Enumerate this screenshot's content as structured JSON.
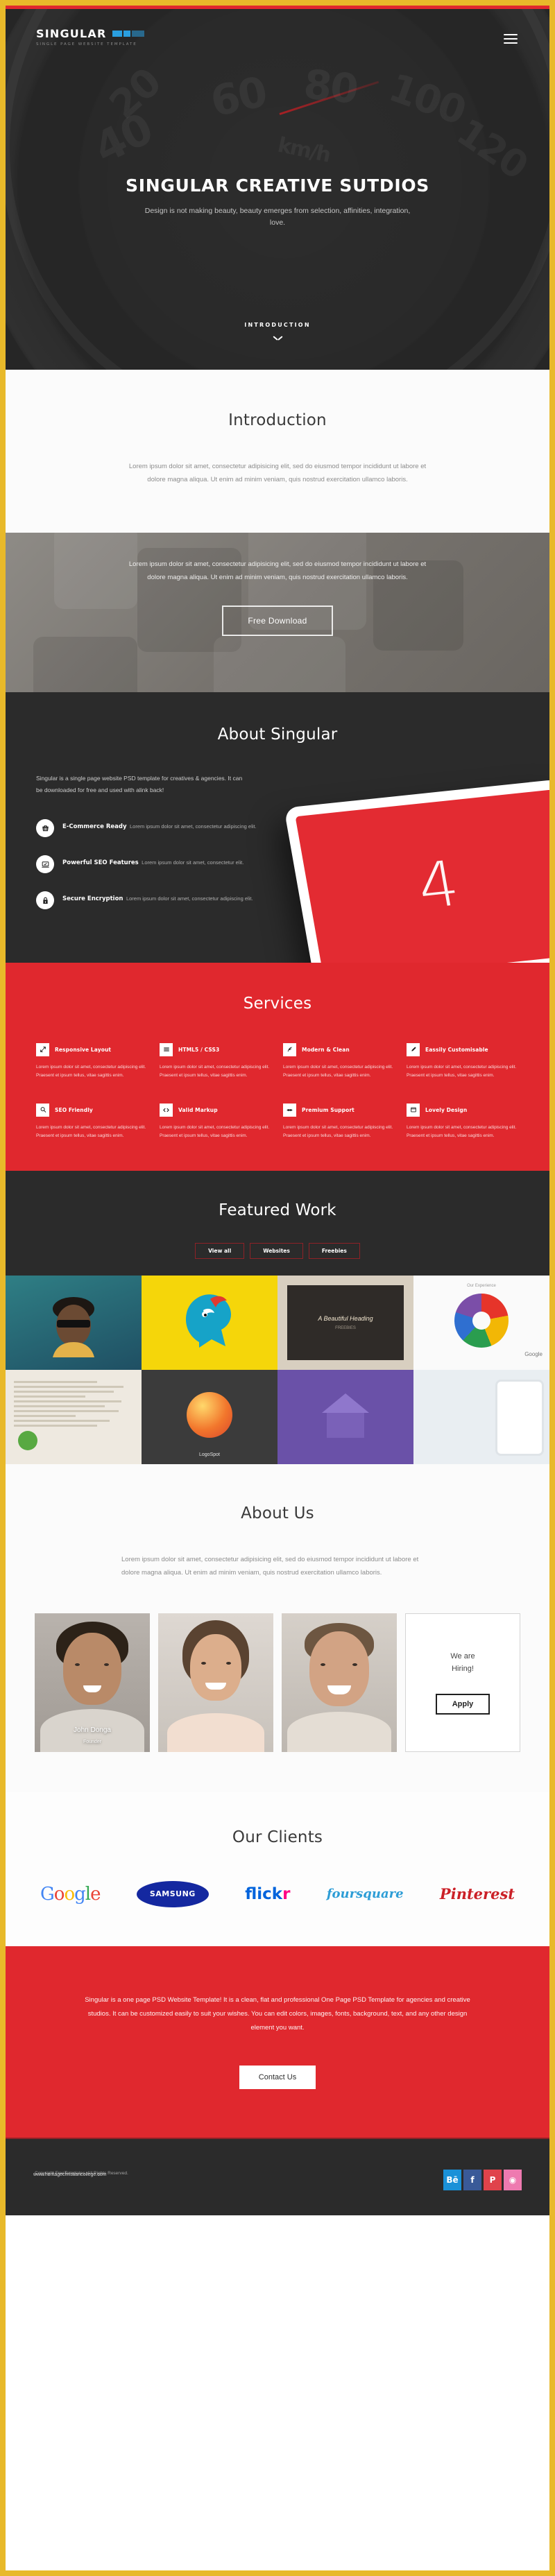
{
  "brand": {
    "logo_text": "SINGULAR",
    "logo_sub": "SINGLE PAGE WEBSITE TEMPLATE",
    "accent_red": "#e0282e",
    "accent_blue": "#2a9fe0",
    "page_border": "#e8b92a"
  },
  "hero": {
    "title": "SINGULAR CREATIVE SUTDIOS",
    "subtitle": "Design is not making beauty, beauty emerges from selection, affinities, integration, love.",
    "scroll_label": "INTRODUCTION",
    "menu_icon": "hamburger-menu-icon",
    "chevron_icon": "chevron-down-icon",
    "speedo_numbers": [
      "20",
      "40",
      "60",
      "80",
      "100",
      "120",
      "km/h"
    ]
  },
  "introduction": {
    "heading": "Introduction",
    "body": "Lorem ipsum dolor sit amet, consectetur adipisicing elit, sed do eiusmod tempor incididunt ut labore et dolore magna aliqua. Ut enim ad minim veniam, quis nostrud exercitation ullamco laboris."
  },
  "download": {
    "body": "Lorem ipsum dolor sit amet, consectetur adipisicing elit, sed do eiusmod tempor incididunt ut labore et dolore magna aliqua. Ut enim ad minim veniam, quis nostrud exercitation ullamco laboris.",
    "button": "Free Download"
  },
  "about_singular": {
    "heading": "About Singular",
    "lead": "Singular is a single page website PSD template for creatives & agencies. It can be downloaded for free and used with alink back!",
    "features": [
      {
        "icon": "shopping-basket-icon",
        "title": "E-Commerce Ready",
        "desc": "Lorem ipsum dolor sit amet, consectetur adipiscing elit."
      },
      {
        "icon": "laptop-check-icon",
        "title": "Powerful SEO Features",
        "desc": "Lorem ipsum dolor sit amet, consectetur elit."
      },
      {
        "icon": "lock-icon",
        "title": "Secure Encryption",
        "desc": "Lorem ipsum dolor sit amet, consectetur adipiscing elit."
      }
    ],
    "tablet_glyph": "4"
  },
  "services": {
    "heading": "Services",
    "items": [
      {
        "icon": "resize-arrows-icon",
        "title": "Responsive Layout",
        "desc": "Lorem ipsum dolor sit amet, consectetur adipiscing elit. Praesent et ipsum tellus, vitae sagittis enim."
      },
      {
        "icon": "list-lines-icon",
        "title": "HTML5 / CSS3",
        "desc": "Lorem ipsum dolor sit amet, consectetur adipiscing elit. Praesent et ipsum tellus, vitae sagittis enim."
      },
      {
        "icon": "feather-icon",
        "title": "Modern & Clean",
        "desc": "Lorem ipsum dolor sit amet, consectetur adipiscing elit. Praesent et ipsum tellus, vitae sagittis enim."
      },
      {
        "icon": "pencil-icon",
        "title": "Eassily Customisable",
        "desc": "Lorem ipsum dolor sit amet, consectetur adipiscing elit. Praesent et ipsum tellus, vitae sagittis enim."
      },
      {
        "icon": "magnifier-icon",
        "title": "SEO Friendly",
        "desc": "Lorem ipsum dolor sit amet, consectetur adipiscing elit. Praesent et ipsum tellus, vitae sagittis enim."
      },
      {
        "icon": "code-brackets-icon",
        "title": "Valid Markup",
        "desc": "Lorem ipsum dolor sit amet, consectetur adipiscing elit. Praesent et ipsum tellus, vitae sagittis enim."
      },
      {
        "icon": "lifebuoy-icon",
        "title": "Premium Support",
        "desc": "Lorem ipsum dolor sit amet, consectetur adipiscing elit. Praesent et ipsum tellus, vitae sagittis enim."
      },
      {
        "icon": "window-icon",
        "title": "Lovely Design",
        "desc": "Lorem ipsum dolor sit amet, consectetur adipiscing elit. Praesent et ipsum tellus, vitae sagittis enim."
      }
    ]
  },
  "featured_work": {
    "heading": "Featured Work",
    "filters": [
      "View all",
      "Websites",
      "Freebies"
    ],
    "active_filter": "View all",
    "tiles": [
      {
        "name": "portrait-sunglasses-thumb",
        "caption": ""
      },
      {
        "name": "dragon-illustration-thumb",
        "caption": ""
      },
      {
        "name": "beautiful-heading-thumb",
        "caption": "A Beautiful Heading"
      },
      {
        "name": "pie-chart-google-thumb",
        "caption": "Google"
      },
      {
        "name": "seo-document-thumb",
        "caption": ""
      },
      {
        "name": "logo-spot-thumb",
        "caption": "LogoSpot"
      },
      {
        "name": "purple-houses-thumb",
        "caption": ""
      },
      {
        "name": "tablet-ui-thumb",
        "caption": ""
      }
    ],
    "tile3_sub": "FREEBIES",
    "tile4_label": "Our Experience"
  },
  "about_us": {
    "heading": "About Us",
    "body": "Lorem ipsum dolor sit amet, consectetur adipisicing elit, sed do eiusmod tempor incididunt ut labore et dolore magna aliqua. Ut enim ad minim veniam, quis nostrud exercitation ullamco laboris.",
    "members": [
      {
        "name": "John Donga",
        "role": "Founder"
      },
      {
        "name": "",
        "role": ""
      },
      {
        "name": "",
        "role": ""
      }
    ],
    "hiring_title": "We are\nHiring!",
    "hiring_line1": "We are",
    "hiring_line2": "Hiring!",
    "apply_label": "Apply"
  },
  "clients": {
    "heading": "Our Clients",
    "logos": [
      "Google",
      "SAMSUNG",
      "flickr",
      "foursquare",
      "Pinterest"
    ]
  },
  "cta": {
    "body": "Singular is a one page PSD Website Template! It is a clean, flat and professional One Page PSD Template for agencies and creative studios. It can be customized easily to suit your wishes. You can edit colors, images, fonts, background, text, and any other design element you want.",
    "button": "Contact Us"
  },
  "footer": {
    "copyright": "Copyright FreeTemplates. All Rights Reserved.",
    "watermark": "www.heritagechristiancollege.com",
    "social": [
      {
        "name": "behance-icon",
        "glyph": "Bē",
        "color": "#1a91d8"
      },
      {
        "name": "facebook-icon",
        "glyph": "f",
        "color": "#3a5a98"
      },
      {
        "name": "pinterest-icon",
        "glyph": "P",
        "color": "#e0434b"
      },
      {
        "name": "dribbble-icon",
        "glyph": "◉",
        "color": "#ee7ab0"
      }
    ]
  }
}
